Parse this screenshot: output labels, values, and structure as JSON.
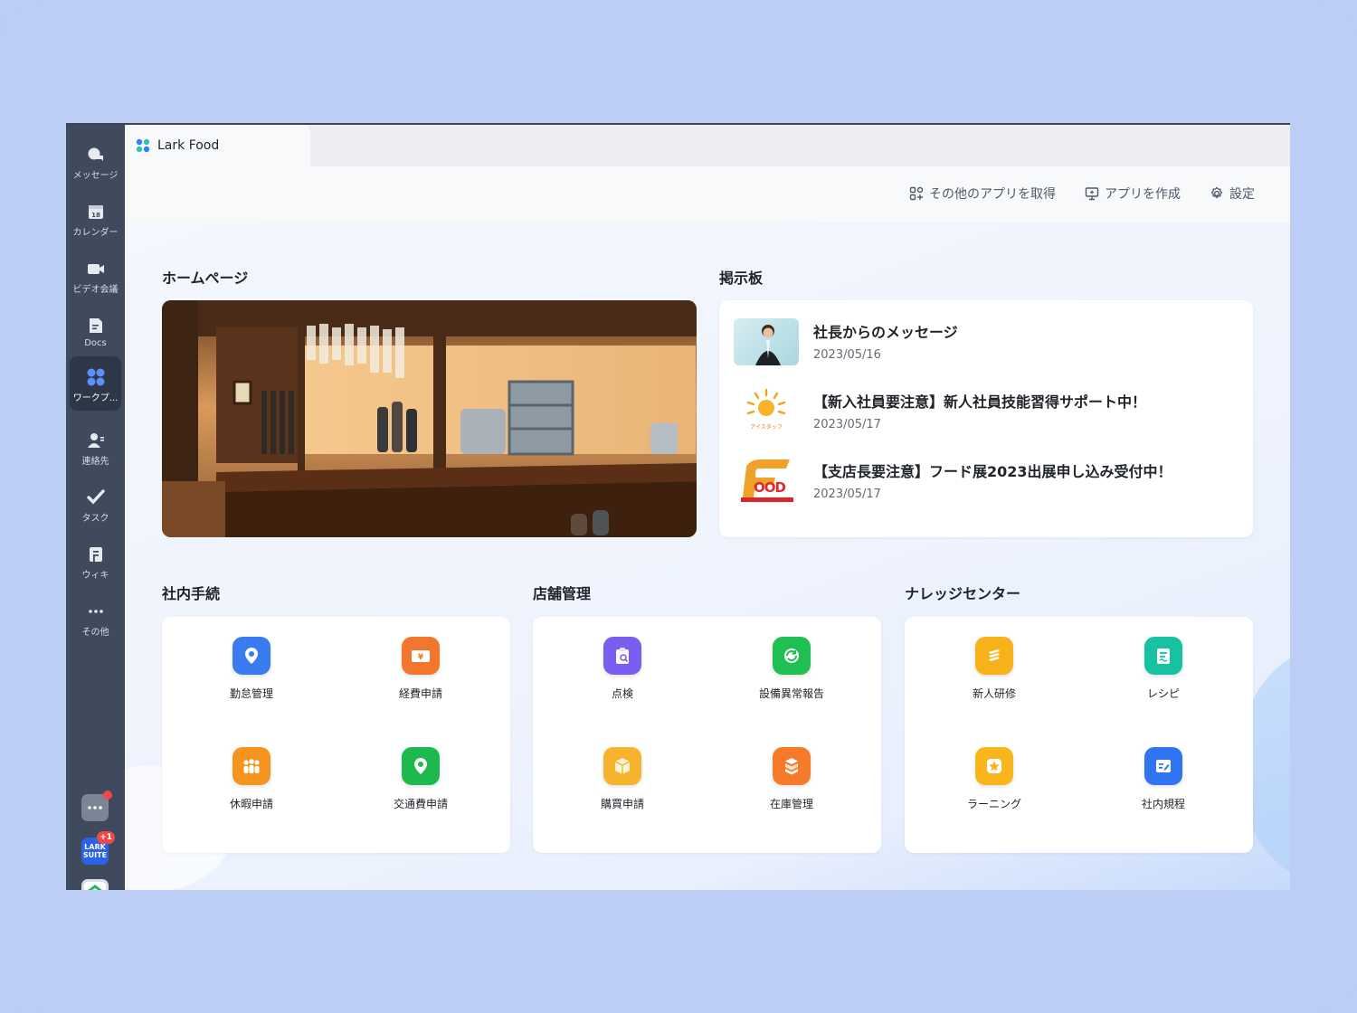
{
  "sidebar": {
    "items": [
      {
        "label": "メッセージ",
        "icon": "chat-bubble-icon"
      },
      {
        "label": "カレンダー",
        "icon": "calendar-icon",
        "day": "18"
      },
      {
        "label": "ビデオ会議",
        "icon": "video-camera-icon"
      },
      {
        "label": "Docs",
        "icon": "docs-icon"
      },
      {
        "label": "ワークプ...",
        "icon": "workplace-icon"
      },
      {
        "label": "連絡先",
        "icon": "contacts-icon"
      },
      {
        "label": "タスク",
        "icon": "task-check-icon"
      },
      {
        "label": "ウィキ",
        "icon": "wiki-icon"
      },
      {
        "label": "その他",
        "icon": "more-dots-icon"
      }
    ],
    "lark_suite_badge": "+1",
    "lark_suite_label_1": "LARK",
    "lark_suite_label_2": "SUITE"
  },
  "tab": {
    "title": "Lark Food"
  },
  "toolbar": {
    "get_apps": "その他のアプリを取得",
    "create_app": "アプリを作成",
    "settings": "設定"
  },
  "homepage": {
    "title": "ホームページ"
  },
  "board": {
    "title": "掲示板",
    "items": [
      {
        "title": "社長からのメッセージ",
        "date": "2023/05/16"
      },
      {
        "title": "【新入社員要注意】新人社員技能習得サポート中！",
        "date": "2023/05/17",
        "thumb_text": "アイスタッフ"
      },
      {
        "title": "【支店長要注意】フード展2023出展申し込み受付中！",
        "date": "2023/05/17",
        "thumb_text": "OOD"
      }
    ]
  },
  "sections": [
    {
      "title": "社内手続",
      "apps": [
        {
          "label": "勤怠管理",
          "color": "#3a7bf0",
          "icon": "location-pin-icon"
        },
        {
          "label": "経費申請",
          "color": "#f2762e",
          "icon": "yen-ticket-icon"
        },
        {
          "label": "休暇申請",
          "color": "#f59520",
          "icon": "people-group-icon"
        },
        {
          "label": "交通費申請",
          "color": "#1db94e",
          "icon": "map-pin-icon"
        }
      ]
    },
    {
      "title": "店舗管理",
      "apps": [
        {
          "label": "点検",
          "color": "#7a5ef0",
          "icon": "clipboard-search-icon"
        },
        {
          "label": "設備異常報告",
          "color": "#1fbf52",
          "icon": "refresh-alert-icon"
        },
        {
          "label": "購買申請",
          "color": "#f7b32b",
          "icon": "package-box-icon"
        },
        {
          "label": "在庫管理",
          "color": "#f57a2a",
          "icon": "stacked-boxes-icon"
        }
      ]
    },
    {
      "title": "ナレッジセンター",
      "apps": [
        {
          "label": "新人研修",
          "color": "#f7b21b",
          "icon": "layers-icon"
        },
        {
          "label": "レシピ",
          "color": "#17c2a1",
          "icon": "recipe-document-icon"
        },
        {
          "label": "ラーニング",
          "color": "#f8b51c",
          "icon": "star-badge-icon"
        },
        {
          "label": "社内規程",
          "color": "#2f74f0",
          "icon": "rules-edit-icon"
        }
      ]
    }
  ]
}
